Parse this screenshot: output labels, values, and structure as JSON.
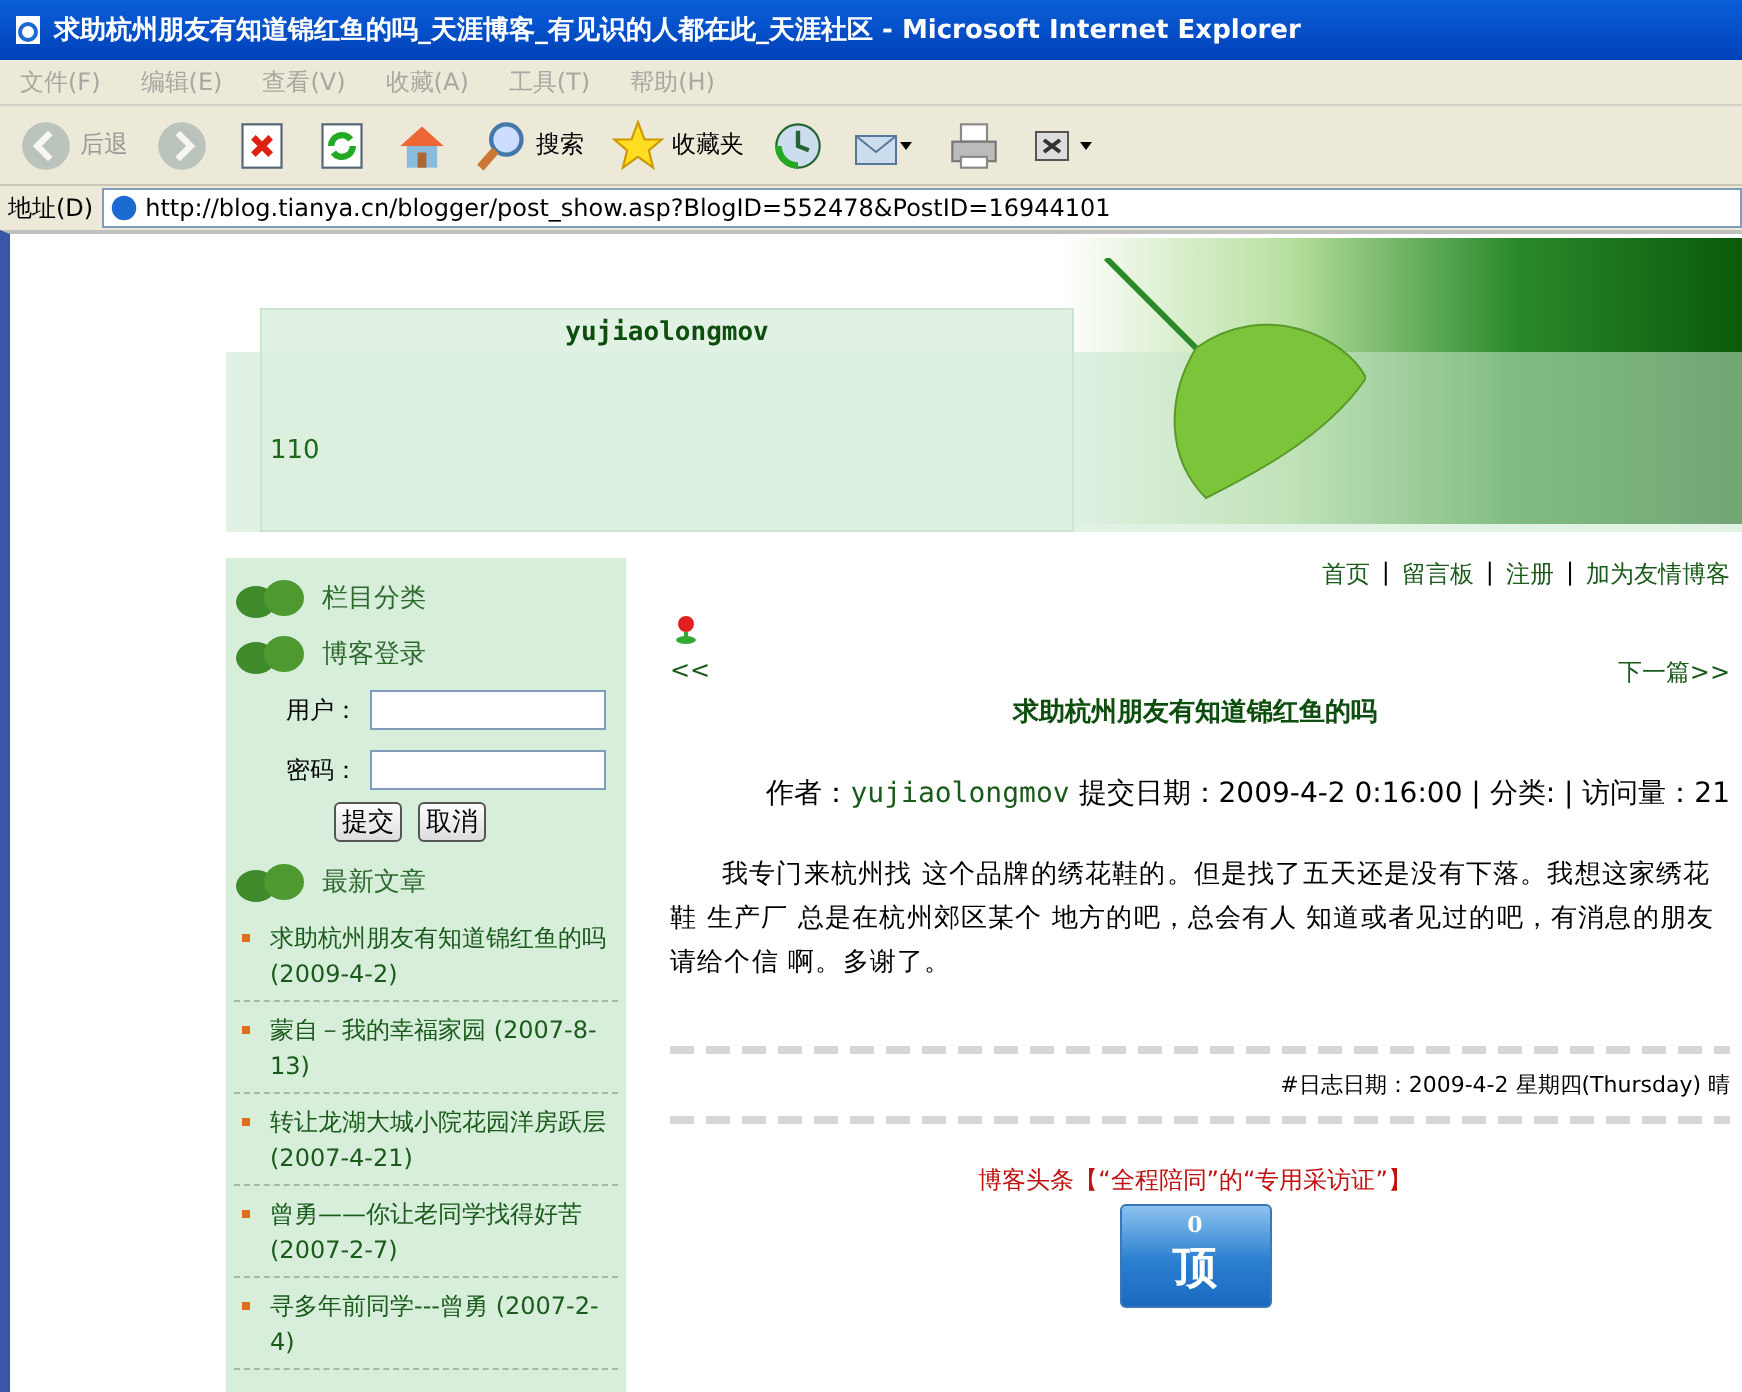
{
  "window": {
    "title": "求助杭州朋友有知道锦红鱼的吗_天涯博客_有见识的人都在此_天涯社区 - Microsoft Internet Explorer"
  },
  "menu": [
    "文件(F)",
    "编辑(E)",
    "查看(V)",
    "收藏(A)",
    "工具(T)",
    "帮助(H)"
  ],
  "toolbar": [
    {
      "kind": "back",
      "label": "后退",
      "disabled": true
    },
    {
      "kind": "forward",
      "disabled": true
    },
    {
      "kind": "stop"
    },
    {
      "kind": "refresh"
    },
    {
      "kind": "home"
    },
    {
      "kind": "search",
      "label": "搜索"
    },
    {
      "kind": "favorites",
      "label": "收藏夹"
    },
    {
      "kind": "history"
    },
    {
      "kind": "mail"
    },
    {
      "kind": "print"
    },
    {
      "kind": "edit"
    }
  ],
  "address": {
    "label": "地址(D)",
    "url": "http://blog.tianya.cn/blogger/post_show.asp?BlogID=552478&PostID=16944101"
  },
  "banner": {
    "blog_name": "yujiaolongmov",
    "count": "110"
  },
  "sidebar": {
    "categories_heading": "栏目分类",
    "login_heading": "博客登录",
    "user_label": "用户：",
    "password_label": "密码：",
    "buttons": [
      "提交",
      "取消"
    ],
    "latest_heading": "最新文章",
    "articles": [
      {
        "title": "求助杭州朋友有知道锦红鱼的吗",
        "date": "(2009-4-2)"
      },
      {
        "title": "蒙自－我的幸福家园",
        "date": "(2007-8-13)"
      },
      {
        "title": "转让龙湖大城小院花园洋房跃层",
        "date": "(2007-4-21)"
      },
      {
        "title": "曾勇——你让老同学找得好苦",
        "date": "(2007-2-7)"
      },
      {
        "title": "寻多年前同学---曾勇",
        "date": "(2007-2-4)"
      }
    ]
  },
  "content": {
    "nav_links": [
      "首页",
      "留言板",
      "注册",
      "加为友情博客"
    ],
    "nav_separator": "|",
    "prev": "<<",
    "next": "下一篇>>",
    "post_title": "求助杭州朋友有知道锦红鱼的吗",
    "author_label": "作者：",
    "author": "yujiaolongmov",
    "meta": "提交日期：2009-4-2 0:16:00 | 分类: | 访问量：21",
    "body": "我专门来杭州找 这个品牌的绣花鞋的。但是找了五天还是没有下落。我想这家绣花鞋 生产厂 总是在杭州郊区某个 地方的吧，总会有人 知道或者见过的吧，有消息的朋友请给个信 啊。多谢了。",
    "log_date": "#日志日期：2009-4-2 星期四(Thursday) 晴",
    "headline": "博客头条【“全程陪同”的“专用采访证”】",
    "vote": {
      "count": "0",
      "label": "顶"
    }
  }
}
